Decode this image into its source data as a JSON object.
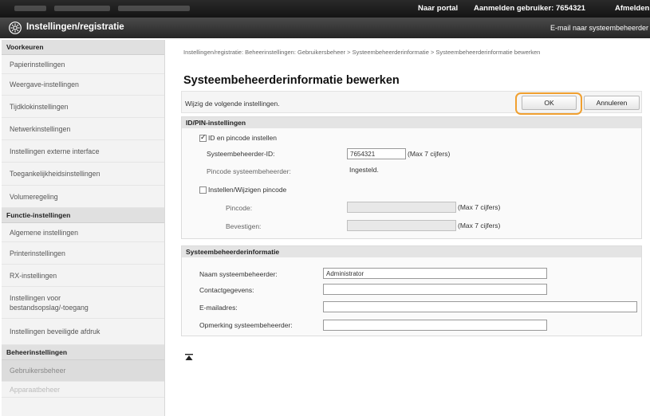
{
  "topbar": {
    "portal_link": "Naar portal",
    "login_label": "Aanmelden gebruiker: 7654321",
    "logout_link": "Afmelden"
  },
  "header": {
    "title": "Instellingen/registratie",
    "mail_link": "E-mail naar systeembeheerder"
  },
  "sidebar": {
    "group1": "Voorkeuren",
    "prefs": [
      "Papierinstellingen",
      "Weergave-instellingen",
      "Tijdklokinstellingen",
      "Netwerkinstellingen",
      "Instellingen externe interface",
      "Toegankelijkheidsinstellingen",
      "Volumeregeling"
    ],
    "group2": "Functie-instellingen",
    "funcs": [
      "Algemene instellingen",
      "Printerinstellingen",
      "RX-instellingen"
    ],
    "func_storage_line1": "Instellingen voor",
    "func_storage_line2": "bestandsopslag/-toegang",
    "func_secure": "Instellingen beveiligde afdruk",
    "group3": "Beheerinstellingen",
    "admin_active": "Gebruikersbeheer",
    "admin_faded": "Apparaatbeheer"
  },
  "main": {
    "breadcrumb": "Instellingen/registratie: Beheerinstellingen: Gebruikersbeheer > Systeembeheerderinformatie > Systeembeheerderinformatie bewerken",
    "title": "Systeembeheerderinformatie bewerken",
    "description": "Wijzig de volgende instellingen.",
    "ok_label": "OK",
    "cancel_label": "Annuleren"
  },
  "idpin": {
    "heading": "ID/PIN-instellingen",
    "set_id_pin_label": "ID en pincode instellen",
    "set_id_pin_checked": true,
    "admin_id_label": "Systeembeheerder-ID:",
    "admin_id_value": "7654321",
    "admin_id_hint": "(Max 7 cijfers)",
    "pin_status_label": "Pincode systeembeheerder:",
    "pin_status_value": "Ingesteld.",
    "change_pin_label": "Instellen/Wijzigen pincode",
    "change_pin_checked": false,
    "pin_label": "Pincode:",
    "pin_hint": "(Max 7 cijfers)",
    "confirm_label": "Bevestigen:",
    "confirm_hint": "(Max 7 cijfers)"
  },
  "info": {
    "heading": "Systeembeheerderinformatie",
    "name_label": "Naam systeembeheerder:",
    "name_value": "Administrator",
    "contact_label": "Contactgegevens:",
    "contact_value": "",
    "email_label": "E-mailadres:",
    "email_value": "",
    "comment_label": "Opmerking systeembeheerder:",
    "comment_value": ""
  },
  "colors": {
    "highlight_ring": "#f0a030",
    "topbar_bg": "#1c1c1c",
    "titlebar_bg": "#363636"
  }
}
